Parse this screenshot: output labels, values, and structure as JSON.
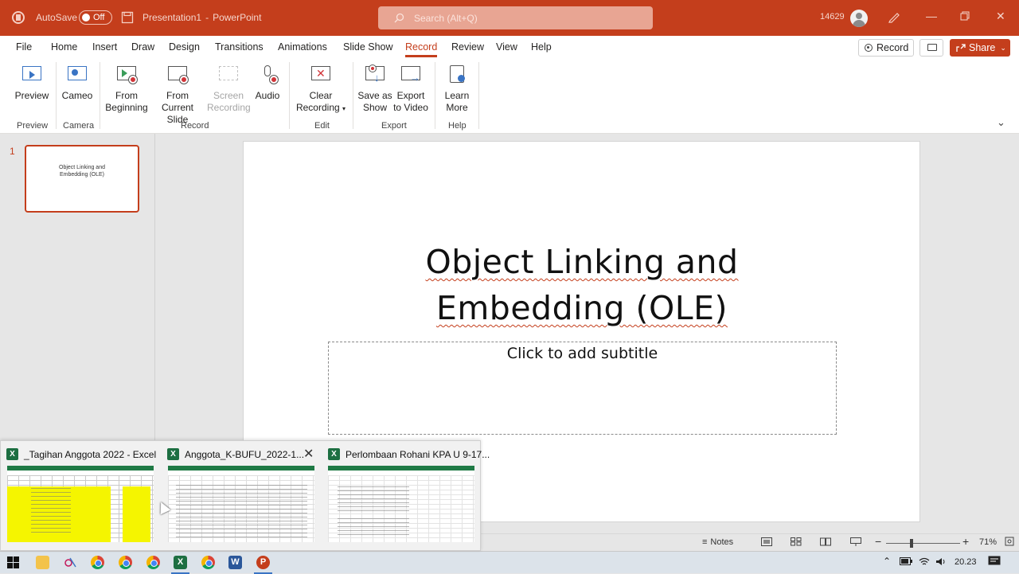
{
  "titlebar": {
    "autosave_label": "AutoSave",
    "autosave_state": "Off",
    "doc_title": "Presentation1",
    "separator": "-",
    "app_name": "PowerPoint",
    "search_placeholder": "Search (Alt+Q)",
    "user_id": "14629"
  },
  "menu": {
    "items": [
      "File",
      "Home",
      "Insert",
      "Draw",
      "Design",
      "Transitions",
      "Animations",
      "Slide Show",
      "Record",
      "Review",
      "View",
      "Help"
    ],
    "active": "Record",
    "record_button": "Record",
    "share_button": "Share"
  },
  "ribbon": {
    "buttons": {
      "preview": [
        "Preview"
      ],
      "cameo": [
        "Cameo"
      ],
      "from_beginning": [
        "From",
        "Beginning"
      ],
      "from_current": [
        "From",
        "Current Slide"
      ],
      "screen_recording": [
        "Screen",
        "Recording"
      ],
      "audio": [
        "Audio"
      ],
      "clear_recording": [
        "Clear",
        "Recording"
      ],
      "save_as_show": [
        "Save as",
        "Show"
      ],
      "export_video": [
        "Export",
        "to Video"
      ],
      "learn_more": [
        "Learn",
        "More"
      ]
    },
    "groups": [
      "Preview",
      "Camera",
      "Record",
      "Edit",
      "Export",
      "Help"
    ]
  },
  "slides_pane": {
    "slide_number": "1",
    "thumb_title": "Object Linking and Embedding (OLE)"
  },
  "slide": {
    "title_line1": "Object Linking and",
    "title_line2": "Embedding (OLE)",
    "subtitle_placeholder": "Click to add subtitle"
  },
  "statusbar": {
    "notes": "Notes",
    "zoom": "71%"
  },
  "taskbar_preview": {
    "windows": [
      {
        "title": "_Tagihan Anggota 2022 - Excel"
      },
      {
        "title": "Anggota_K-BUFU_2022-1..."
      },
      {
        "title": "Perlombaan Rohani KPA U 9-17..."
      }
    ]
  },
  "tray": {
    "time": "20.23"
  },
  "colors": {
    "accent": "#c43e1c",
    "excel_green": "#1d6f42"
  }
}
